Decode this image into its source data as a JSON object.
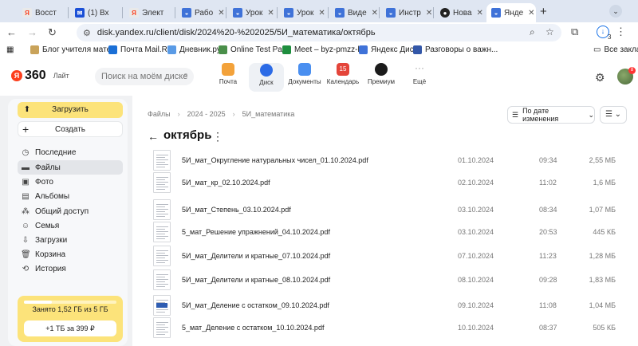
{
  "browser": {
    "tabs": [
      {
        "title": "Восст",
        "icon": "yandex-tab-icon",
        "color": "#fc3f1d"
      },
      {
        "title": "(1) Вх",
        "icon": "mail-tab-icon",
        "color": "#1a4fd6"
      },
      {
        "title": "Элект",
        "icon": "yandex-tab-icon",
        "color": "#fc3f1d"
      },
      {
        "title": "Рабо",
        "icon": "disk-tab-icon",
        "color": "#3f72d8"
      },
      {
        "title": "Урок",
        "icon": "disk-tab-icon",
        "color": "#3f72d8"
      },
      {
        "title": "Урок",
        "icon": "disk-tab-icon",
        "color": "#3f72d8"
      },
      {
        "title": "Виде",
        "icon": "disk-tab-icon",
        "color": "#3f72d8"
      },
      {
        "title": "Инстр",
        "icon": "disk-tab-icon",
        "color": "#3f72d8"
      },
      {
        "title": "Нова",
        "icon": "github-tab-icon",
        "color": "#222222"
      },
      {
        "title": "Янде",
        "icon": "disk-tab-icon",
        "color": "#3f72d8"
      }
    ],
    "url": "disk.yandex.ru/client/disk/2024%20-%202025/5И_математика/октябрь",
    "download_count": "3",
    "bookmarks": [
      {
        "label": "Блог учителя мате...",
        "color": "#c9a35a"
      },
      {
        "label": "Почта Mail.Ru",
        "color": "#1a6fd6"
      },
      {
        "label": "Дневник.ру",
        "color": "#5a9be6"
      },
      {
        "label": "Online Test Pad",
        "color": "#4a8f4a"
      },
      {
        "label": "Meet – byz-pmzz-k...",
        "color": "#1e8e3e"
      },
      {
        "label": "Яндекс Диск",
        "color": "#3f72d8"
      },
      {
        "label": "Разговоры о важн...",
        "color": "#3357a8"
      }
    ],
    "all_bookmarks": "Все заклад"
  },
  "header": {
    "logo_number": "360",
    "logo_plan": "Лайт",
    "search_placeholder": "Поиск на моём диске",
    "services": [
      {
        "label": "Почта",
        "color": "#f3a23a"
      },
      {
        "label": "Диск",
        "color": "#2c6be6"
      },
      {
        "label": "Документы",
        "color": "#4a8ff0"
      },
      {
        "label": "Календарь",
        "badge": "15",
        "color": "#e4453a"
      },
      {
        "label": "Премиум",
        "color": "#1b1b1b"
      },
      {
        "label": "Ещё",
        "color": "#999999"
      }
    ],
    "notifications": "8"
  },
  "sidebar": {
    "upload_label": "Загрузить",
    "create_label": "Создать",
    "items": [
      {
        "label": "Последние",
        "icon": "clock-icon"
      },
      {
        "label": "Файлы",
        "icon": "files-icon"
      },
      {
        "label": "Фото",
        "icon": "photo-icon"
      },
      {
        "label": "Альбомы",
        "icon": "albums-icon"
      },
      {
        "label": "Общий доступ",
        "icon": "shared-icon"
      },
      {
        "label": "Семья",
        "icon": "family-icon"
      },
      {
        "label": "Загрузки",
        "icon": "downloads-icon"
      },
      {
        "label": "Корзина",
        "icon": "trash-icon"
      },
      {
        "label": "История",
        "icon": "history-icon"
      }
    ],
    "active_item": "Файлы",
    "storage_text": "Занято 1,52 ГБ из 5 ГБ",
    "storage_used_fraction": 0.304,
    "buy_label": "+1 ТБ за 399 ₽"
  },
  "main": {
    "breadcrumbs": [
      "Файлы",
      "2024 - 2025",
      "5И_математика"
    ],
    "folder_title": "октябрь",
    "sort_label": "По дате изменения",
    "files": [
      {
        "name": "5И_мат_Округление натуральных чисел_01.10.2024.pdf",
        "date": "01.10.2024",
        "time": "09:34",
        "size": "2,55 МБ",
        "thumb": "doc"
      },
      {
        "name": "5И_мат_кр_02.10.2024.pdf",
        "date": "02.10.2024",
        "time": "11:02",
        "size": "1,6 МБ",
        "thumb": "doc"
      },
      {
        "name": "5И_мат_Степень_03.10.2024.pdf",
        "date": "03.10.2024",
        "time": "08:34",
        "size": "1,07 МБ",
        "thumb": "doc"
      },
      {
        "name": "5_мат_Решение упражнений_04.10.2024.pdf",
        "date": "03.10.2024",
        "time": "20:53",
        "size": "445 КБ",
        "thumb": "doc"
      },
      {
        "name": "5И_мат_Делители и кратные_07.10.2024.pdf",
        "date": "07.10.2024",
        "time": "11:23",
        "size": "1,28 МБ",
        "thumb": "doc"
      },
      {
        "name": "5И_мат_Делители и кратные_08.10.2024.pdf",
        "date": "08.10.2024",
        "time": "09:28",
        "size": "1,83 МБ",
        "thumb": "doc"
      },
      {
        "name": "5И_мат_Деление с остатком_09.10.2024.pdf",
        "date": "09.10.2024",
        "time": "11:08",
        "size": "1,04 МБ",
        "thumb": "blue"
      },
      {
        "name": "5_мат_Деление с остатком_10.10.2024.pdf",
        "date": "10.10.2024",
        "time": "08:37",
        "size": "505 КБ",
        "thumb": "doc"
      }
    ]
  }
}
